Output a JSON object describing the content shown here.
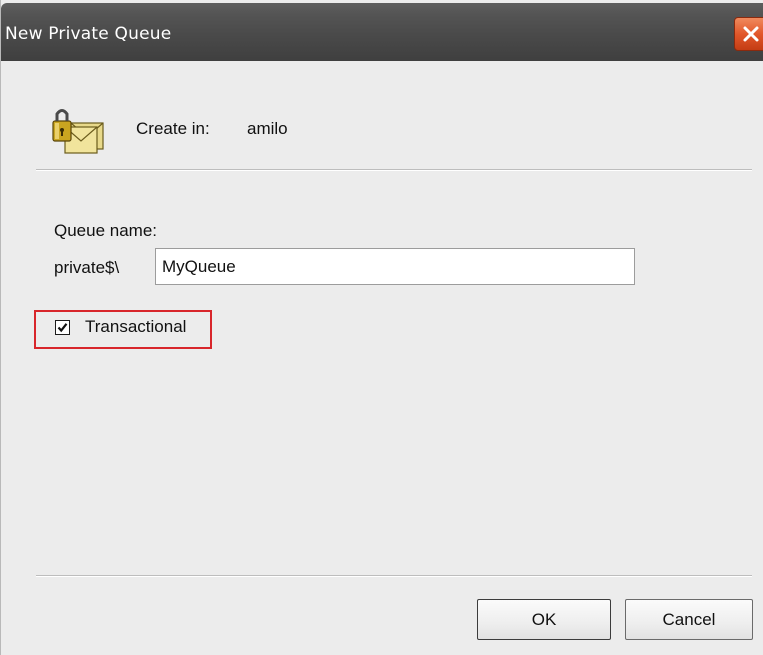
{
  "window": {
    "title": "New Private Queue"
  },
  "header": {
    "create_in_label": "Create in:",
    "create_in_value": "amilo",
    "icon": "queue-folder-lock-icon"
  },
  "form": {
    "queue_name_label": "Queue name:",
    "prefix_label": "private$\\",
    "queue_name_value": "MyQueue",
    "transactional_label": "Transactional",
    "transactional_checked": true
  },
  "buttons": {
    "ok": "OK",
    "cancel": "Cancel"
  },
  "colors": {
    "titlebar": "#4a4a4a",
    "highlight": "#d8262b",
    "close": "#e2572a",
    "dialog": "#ececec"
  }
}
